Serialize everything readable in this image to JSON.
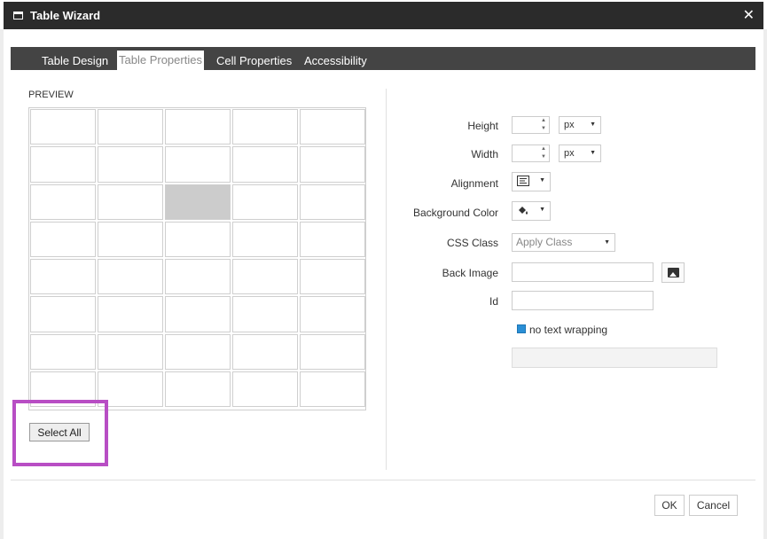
{
  "window": {
    "title": "Table Wizard",
    "close_glyph": "✕"
  },
  "tabs": [
    {
      "label": "Table Design",
      "active": false
    },
    {
      "label": "Table Properties",
      "active": true
    },
    {
      "label": "Cell Properties",
      "active": false
    },
    {
      "label": "Accessibility",
      "active": false
    }
  ],
  "preview": {
    "label": "PREVIEW",
    "rows": 8,
    "cols": 5,
    "selected_cell": {
      "row": 3,
      "col": 3
    },
    "select_all_label": "Select All"
  },
  "properties": {
    "height_label": "Height",
    "height_value": "",
    "height_unit": "px",
    "width_label": "Width",
    "width_value": "",
    "width_unit": "px",
    "alignment_label": "Alignment",
    "alignment_icon": "align-left-icon",
    "background_color_label": "Background Color",
    "background_icon": "paint-bucket-icon",
    "css_class_label": "CSS Class",
    "css_class_placeholder": "Apply Class",
    "back_image_label": "Back Image",
    "back_image_value": "",
    "id_label": "Id",
    "id_value": "",
    "no_wrap_label": "no text wrapping",
    "no_wrap_checked": true
  },
  "footer": {
    "ok_label": "OK",
    "cancel_label": "Cancel"
  },
  "colors": {
    "titlebar": "#2b2b2b",
    "tabbar": "#444444",
    "highlight": "#b84ec4",
    "selected_cell": "#cccccc",
    "checkbox": "#2a8fd6"
  }
}
